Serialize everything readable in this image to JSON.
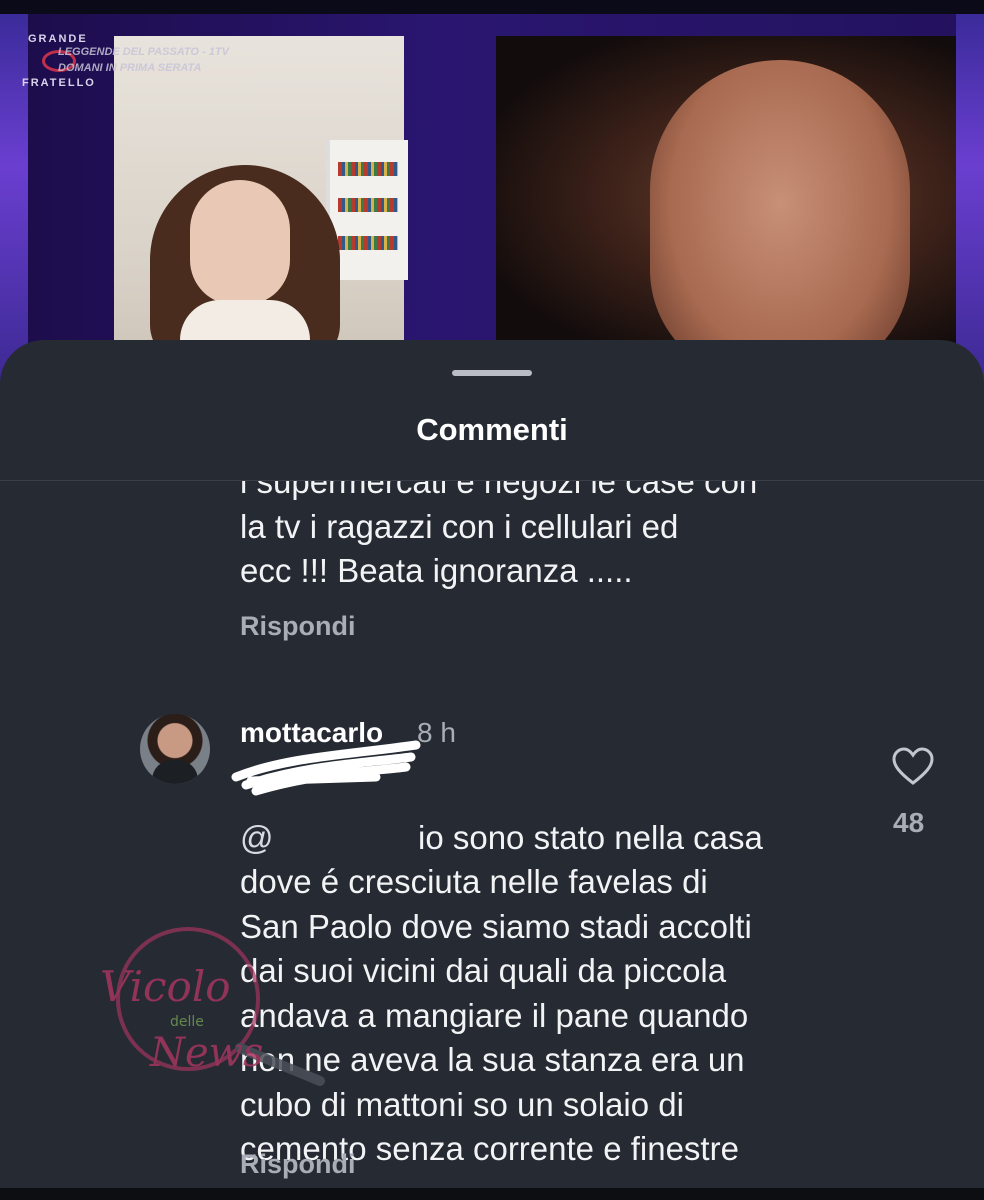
{
  "video": {
    "logo_text": [
      "GRANDE",
      "FRATELLO"
    ],
    "caption_line1": "LEGGENDE DEL PASSATO - 1TV",
    "caption_line2": "DOMANI IN PRIMA SERATA"
  },
  "sheet": {
    "title": "Commenti"
  },
  "comments": [
    {
      "text": "i supermercati e negozi le case con\nla tv i ragazzi con i cellulari ed\necc !!! Beata ignoranza .....",
      "reply_label": "Rispondi"
    },
    {
      "username": "mottacarlo",
      "time": "8 h",
      "mention": "@",
      "text": "io sono stato nella casa\ndove é cresciuta nelle favelas di\nSan Paolo dove siamo stadi accolti\ndai suoi vicini dai quali da piccola\nandava a mangiare il pane quando\nnon ne aveva la sua stanza era un\ncubo di mattoni so un solaio di\ncemento senza corrente e finestre",
      "reply_label": "Rispondi",
      "likes": "48"
    }
  ],
  "watermark": {
    "line1": "Vicolo",
    "line2": "delle",
    "line3": "News"
  },
  "colors": {
    "sheet_bg": "#262a33",
    "text_primary": "#f2f3f5",
    "text_secondary": "#a9adb6",
    "watermark": "#a5355f"
  },
  "icons": [
    "heart-icon",
    "grab-handle"
  ]
}
